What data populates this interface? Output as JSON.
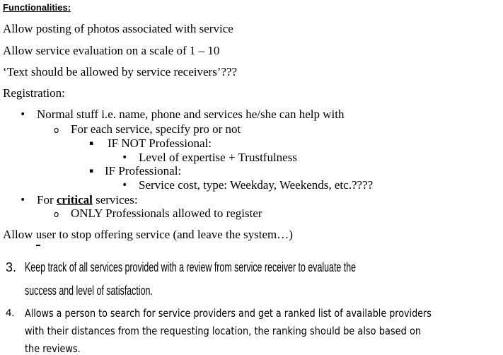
{
  "heading": "Functionalities:",
  "lines": {
    "photos": "Allow posting of photos associated with service",
    "evaluation": "Allow service evaluation on a scale of 1 – 10",
    "text_allowed": "‘Text should be allowed by service receivers’???",
    "registration": "Registration:",
    "normal_stuff": "Normal stuff i.e. name, phone and services he/she can help with",
    "each_service": "For each service, specify pro or not",
    "if_not_pro": "IF NOT Professional:",
    "expertise": "Level of expertise + Trustfulness",
    "if_pro": "IF Professional:",
    "service_cost": "Service cost, type: Weekday, Weekends, etc.????",
    "for_prefix": "For",
    "critical": "critical",
    "services_suffix": "services:",
    "only_pros": "ONLY Professionals allowed to register",
    "stop_offering": "Allow user to stop offering service (and leave the system…)"
  },
  "list_items": [
    {
      "number": "3.",
      "lines": [
        "Keep track of all services provided with a review from service receiver to evaluate the",
        "success and level of satisfaction."
      ]
    },
    {
      "number": "4.",
      "lines": [
        "Allows a person to search for service providers and get a ranked list of available providers",
        "with their distances from the requesting location, the ranking should be also based on",
        "the reviews."
      ]
    }
  ],
  "bullets": {
    "level1": "•",
    "level2": "o",
    "level3": "▪"
  }
}
